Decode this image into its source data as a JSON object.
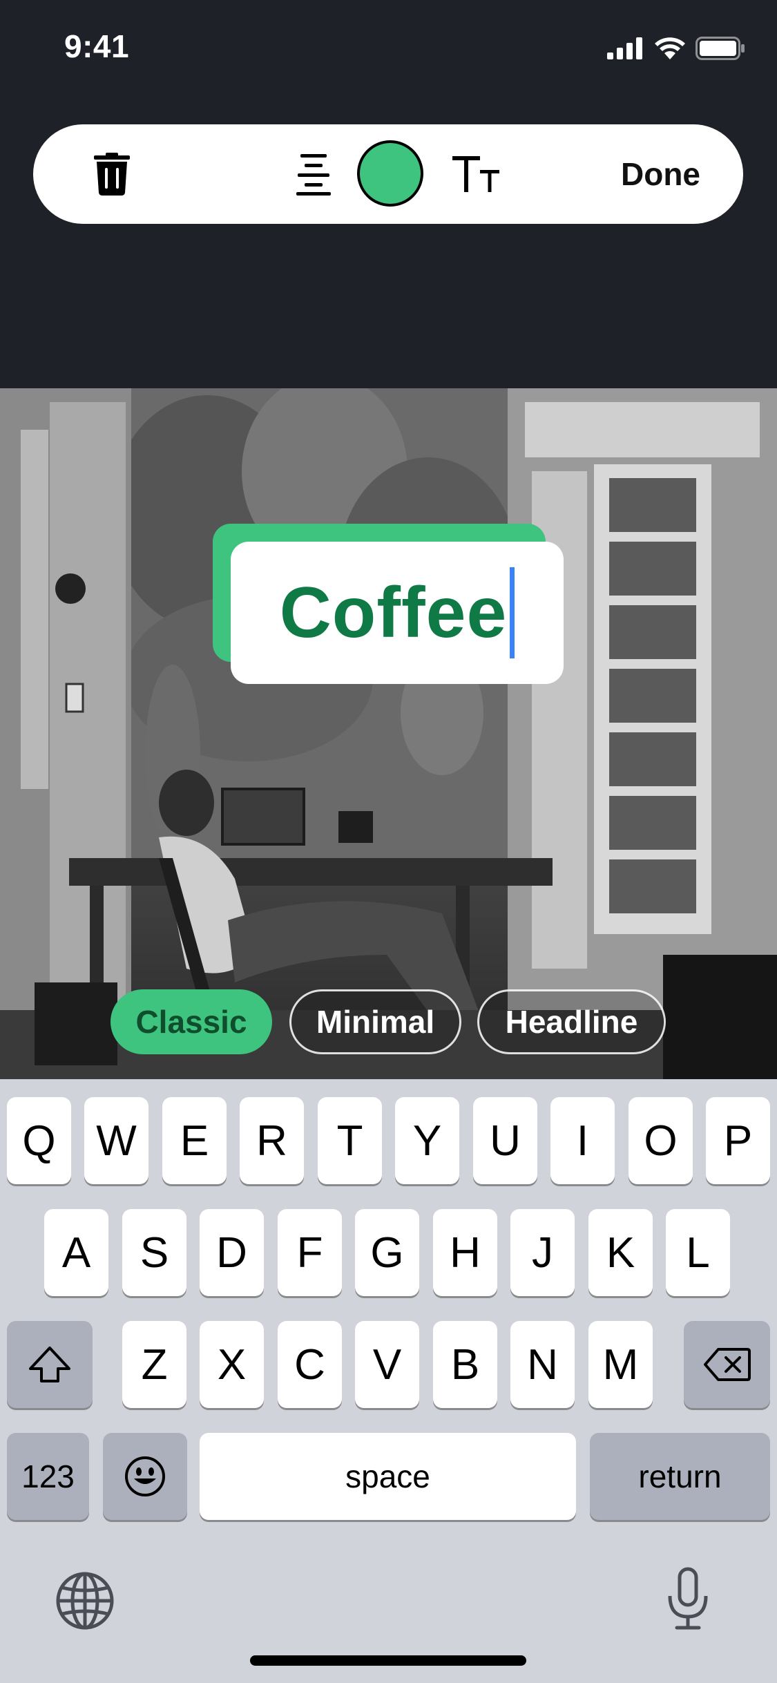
{
  "status_bar": {
    "time": "9:41"
  },
  "toolbar": {
    "done_label": "Done",
    "selected_color": "#3fc47f",
    "icons": [
      "trash-icon",
      "text-align-icon",
      "color-swatch",
      "text-size-icon"
    ]
  },
  "text_overlay": {
    "value": "Coffee",
    "text_color": "#0f7a45",
    "background_color": "#3fc47f"
  },
  "styles": {
    "selected": "Classic",
    "options": [
      "Classic",
      "Minimal",
      "Headline"
    ]
  },
  "keyboard": {
    "row1": [
      "Q",
      "W",
      "E",
      "R",
      "T",
      "Y",
      "U",
      "I",
      "O",
      "P"
    ],
    "row2": [
      "A",
      "S",
      "D",
      "F",
      "G",
      "H",
      "J",
      "K",
      "L"
    ],
    "row3": [
      "Z",
      "X",
      "C",
      "V",
      "B",
      "N",
      "M"
    ],
    "numbers_label": "123",
    "space_label": "space",
    "return_label": "return",
    "icons": [
      "shift-icon",
      "delete-icon",
      "emoji-icon",
      "globe-icon",
      "microphone-icon"
    ]
  }
}
